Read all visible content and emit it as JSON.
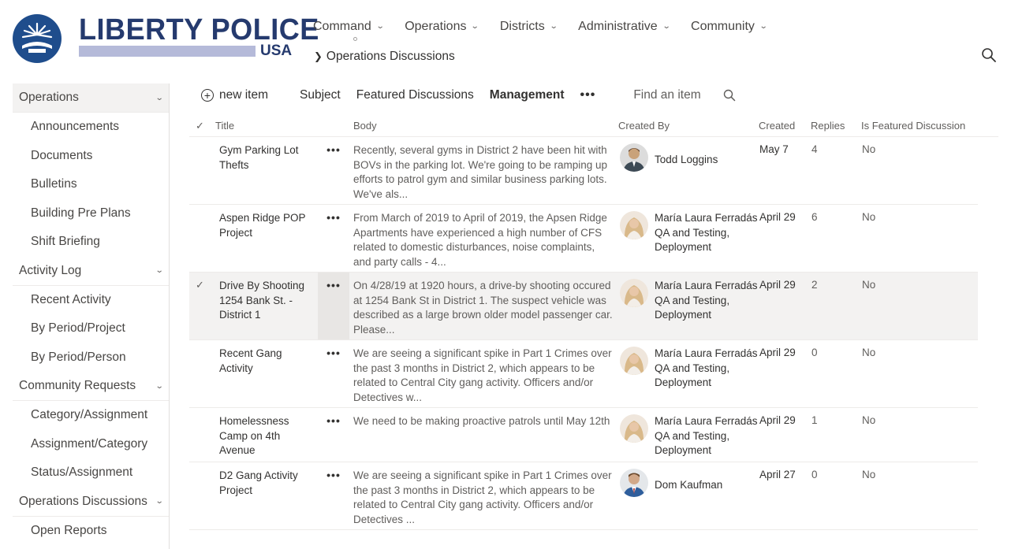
{
  "brand": {
    "title": "LIBERTY POLICE",
    "subtitle": "USA",
    "color": "#253a6e",
    "bar_color": "#b5bad9"
  },
  "topnav": [
    {
      "label": "Command"
    },
    {
      "label": "Operations"
    },
    {
      "label": "Districts"
    },
    {
      "label": "Administrative"
    },
    {
      "label": "Community"
    }
  ],
  "breadcrumb": {
    "current": "Operations Discussions"
  },
  "sidebar": {
    "sections": [
      {
        "label": "Operations",
        "items": [
          "Announcements",
          "Documents",
          "Bulletins",
          "Building Pre Plans",
          "Shift Briefing"
        ]
      },
      {
        "label": "Activity Log",
        "items": [
          "Recent Activity",
          "By Period/Project",
          "By Period/Person"
        ]
      },
      {
        "label": "Community Requests",
        "items": [
          "Category/Assignment",
          "Assignment/Category",
          "Status/Assignment"
        ]
      },
      {
        "label": "Operations Discussions",
        "items": [
          "Open Reports"
        ]
      }
    ]
  },
  "commandbar": {
    "new_item": "new item",
    "views": [
      "Subject",
      "Featured Discussions",
      "Management"
    ],
    "selected_view": "Management",
    "more": "•••",
    "find_placeholder": "Find an item"
  },
  "list": {
    "columns": {
      "title": "Title",
      "body": "Body",
      "created_by": "Created By",
      "created": "Created",
      "replies": "Replies",
      "featured": "Is Featured Discussion"
    },
    "rows": [
      {
        "title": "Gym Parking Lot Thefts",
        "body": "Recently, several gyms in District 2 have been hit with BOVs in the parking lot. We're going to be ramping up efforts to patrol gym and similar business parking lots. We've als...",
        "author": "Todd Loggins",
        "author_detail": "",
        "avatar": "man-avatar",
        "created": "May 7",
        "replies": "4",
        "featured": "No",
        "selected": false
      },
      {
        "title": "Aspen Ridge POP Project",
        "body": "From March of 2019 to April of 2019, the Apsen Ridge Apartments have experienced a high number of CFS related to domestic disturbances, noise complaints, and party calls - 4...",
        "author": "María Laura Ferradás",
        "author_detail": "QA and Testing, Deployment",
        "avatar": "woman-avatar",
        "created": "April 29",
        "replies": "6",
        "featured": "No",
        "selected": false
      },
      {
        "title": "Drive By Shooting 1254 Bank St. - District 1",
        "body": "On 4/28/19 at 1920 hours, a drive-by shooting occured at 1254 Bank St in District 1.  The suspect vehicle was described as a large brown older model passenger car. Please...",
        "author": "María Laura Ferradás",
        "author_detail": "QA and Testing, Deployment",
        "avatar": "woman-avatar",
        "created": "April 29",
        "replies": "2",
        "featured": "No",
        "selected": true
      },
      {
        "title": "Recent Gang Activity",
        "body": "We are seeing a significant spike in Part 1 Crimes over the past 3 months in District 2, which appears to be related to Central City gang activity. Officers and/or Detectives w...",
        "author": "María Laura Ferradás",
        "author_detail": "QA and Testing, Deployment",
        "avatar": "woman-avatar",
        "created": "April 29",
        "replies": "0",
        "featured": "No",
        "selected": false
      },
      {
        "title": "Homelessness Camp on 4th Avenue",
        "body": "We need to be making proactive patrols until May 12th",
        "author": "María Laura Ferradás",
        "author_detail": "QA and Testing, Deployment",
        "avatar": "woman-avatar",
        "created": "April 29",
        "replies": "1",
        "featured": "No",
        "selected": false
      },
      {
        "title": "D2 Gang Activity Project",
        "body": "We are seeing a significant spike in Part 1 Crimes over the past 3 months in District 2, which appears to be related to Central City gang activity. Officers and/or Detectives ...",
        "author": "Dom Kaufman",
        "author_detail": "",
        "avatar": "man-avatar",
        "created": "April 27",
        "replies": "0",
        "featured": "No",
        "selected": false
      }
    ]
  }
}
